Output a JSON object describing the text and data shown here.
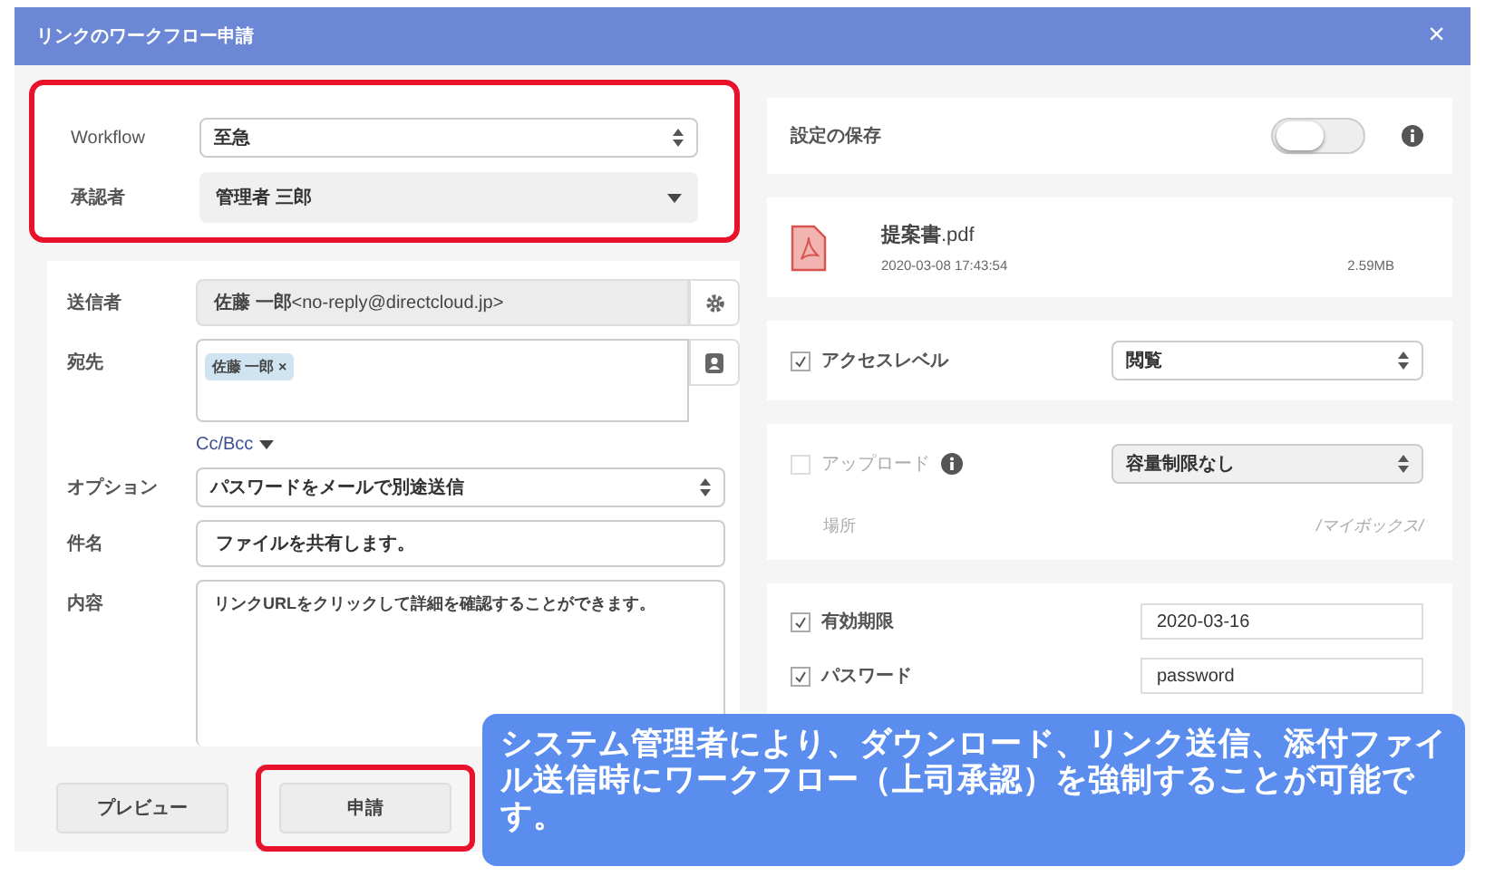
{
  "dialog": {
    "title": "リンクのワークフロー申請",
    "close": "×"
  },
  "workflow_section": {
    "highlighted": true,
    "workflow": {
      "label": "Workflow",
      "value": "至急"
    },
    "approver": {
      "label": "承認者",
      "value": "管理者 三郎"
    }
  },
  "sender": {
    "label": "送信者",
    "value": "**佐藤 一郎**<no-reply@directcloud.jp>"
  },
  "recipients": {
    "label": "宛先",
    "tags": [
      {
        "name": "佐藤 一郎",
        "remove": "×"
      }
    ]
  },
  "cc_bcc": "Cc/Bcc",
  "option": {
    "label": "オプション",
    "value": "パスワードをメールで別途送信"
  },
  "subject": {
    "label": "件名",
    "value": "ファイルを共有します。"
  },
  "message": {
    "label": "内容",
    "value": "リンクURLをクリックして詳細を確認することができます。"
  },
  "buttons": [
    {
      "label": "プレビュー",
      "highlighted": false
    },
    {
      "label": "申請",
      "highlighted": true
    }
  ],
  "save_settings": {
    "label": "設定の保存",
    "on": false
  },
  "file": {
    "name": "**提案書**.pdf",
    "date": "2020-03-08 17:43:54",
    "size": "2.59MB"
  },
  "access_level": {
    "label": "アクセスレベル",
    "checked": true,
    "value": "閲覧"
  },
  "upload": {
    "label": "アップロード",
    "checked": false,
    "disabled": true,
    "value": "容量制限なし",
    "location_label": "場所",
    "location": "/マイボックス/"
  },
  "expiry": {
    "label": "有効期限",
    "checked": true,
    "value": "2020-03-16"
  },
  "password": {
    "label": "パスワード",
    "checked": true,
    "value": "password"
  },
  "callout": "システム管理者により、ダウンロード、リンク送信、添付ファイル送信時にワークフロー（上司承認）を強制することが可能です。"
}
